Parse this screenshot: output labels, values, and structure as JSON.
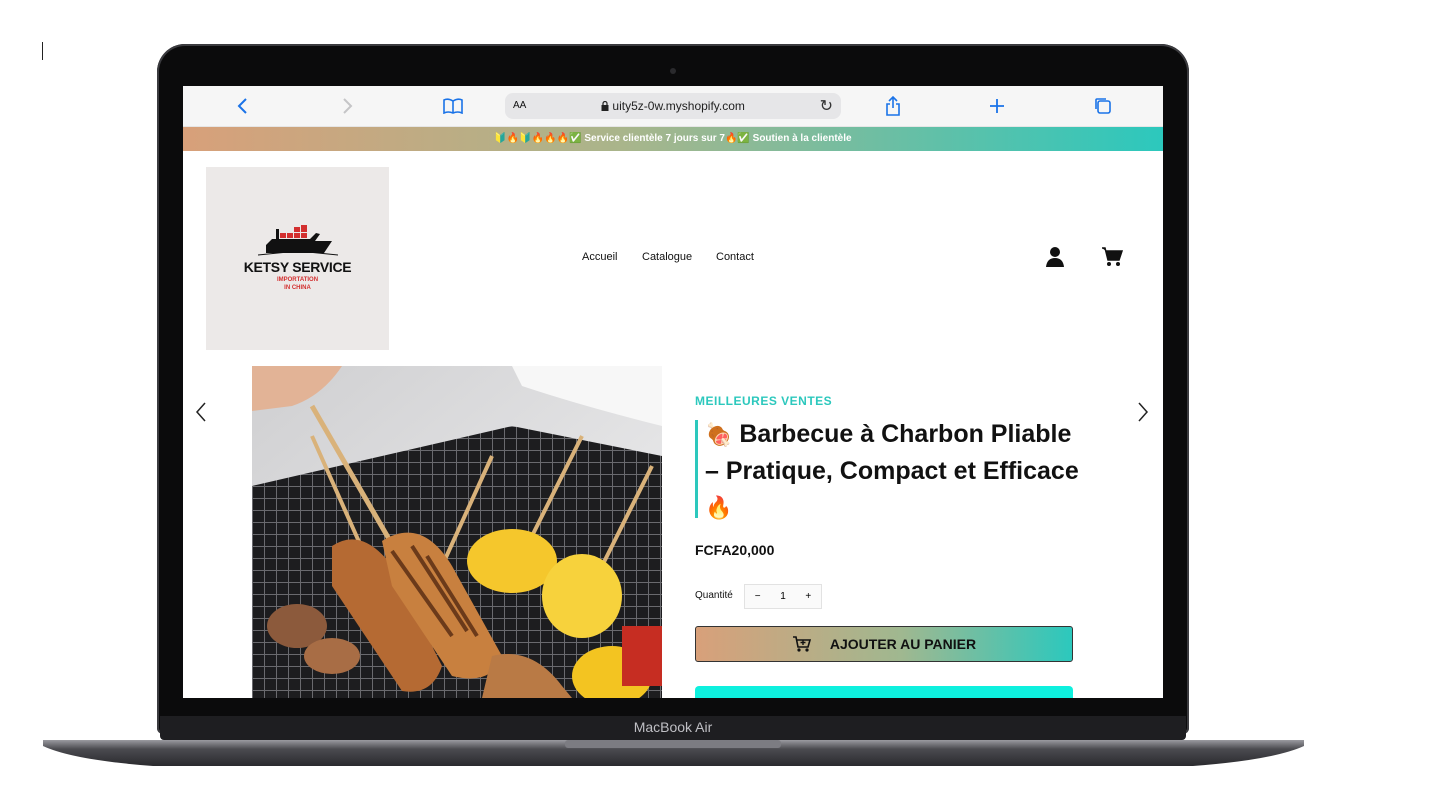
{
  "browser": {
    "address_aa": "AA",
    "url": "uity5z-0w.myshopify.com"
  },
  "announcement": {
    "text": "🔰🔥🔰🔥🔥🔥✅ Service clientèle 7 jours sur 7🔥✅ Soutien à la clientèle"
  },
  "logo": {
    "brand": "KETSY SERVICE",
    "line1": "IMPORTATION",
    "line2": "IN CHINA"
  },
  "nav": {
    "items": [
      "Accueil",
      "Catalogue",
      "Contact"
    ]
  },
  "product": {
    "vendor": "MEILLEURES VENTES",
    "title_emoji_start": "🍖",
    "title_text": "Barbecue à Charbon Pliable – Pratique, Compact et Efficace",
    "title_emoji_end": "🔥",
    "price": "FCFA20,000",
    "quantity_label": "Quantité",
    "quantity_minus": "−",
    "quantity_value": "1",
    "quantity_plus": "+",
    "add_to_cart": "AJOUTER AU PANIER"
  },
  "device": {
    "label": "MacBook Air"
  },
  "colors": {
    "accent": "#2cc8bd",
    "gradient_start": "#d8a07a",
    "buy_now": "#0ef0de"
  }
}
